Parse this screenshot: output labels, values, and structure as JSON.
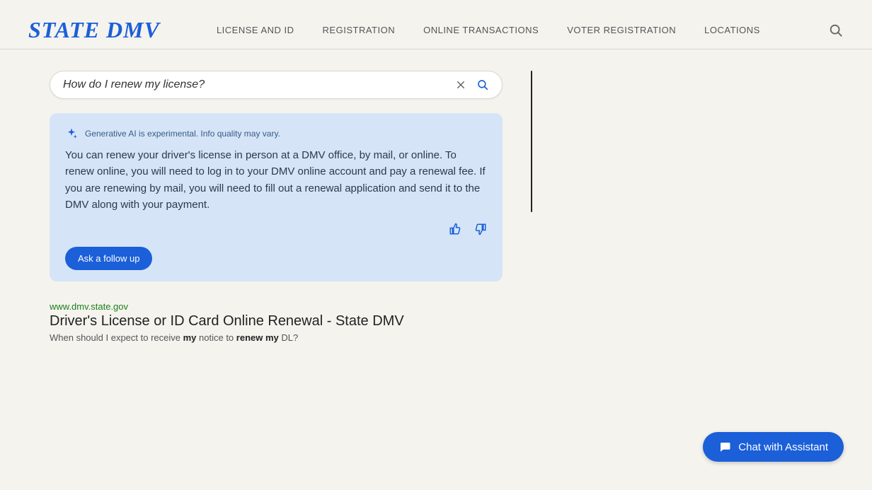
{
  "header": {
    "logo": "STATE DMV",
    "nav": [
      "LICENSE AND ID",
      "REGISTRATION",
      "ONLINE TRANSACTIONS",
      "VOTER REGISTRATION",
      "LOCATIONS"
    ]
  },
  "search": {
    "value": "How do I renew my license?"
  },
  "ai": {
    "disclaimer": "Generative AI is experimental. Info quality may vary.",
    "answer": "You can renew your driver's license in person at a DMV office, by mail, or online. To renew online, you will need to log in to your DMV online account and pay a renewal fee. If you are renewing by mail, you will need to fill out a renewal application and send it to the DMV along with your payment.",
    "followup_label": "Ask a follow up"
  },
  "result": {
    "url": "www.dmv.state.gov",
    "title": "Driver's License or ID Card Online Renewal - State DMV",
    "snippet_prefix": "When should I expect to receive ",
    "snippet_bold1": "my",
    "snippet_mid": " notice to ",
    "snippet_bold2": "renew my",
    "snippet_suffix": " DL?"
  },
  "chat": {
    "label": "Chat with Assistant"
  }
}
